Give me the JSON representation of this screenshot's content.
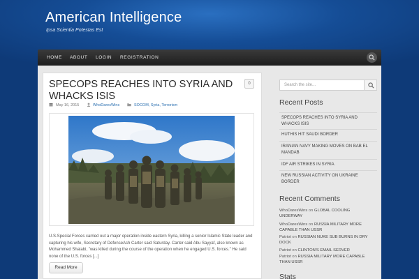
{
  "site": {
    "title": "American Intelligence",
    "tagline": "Ipsa Scientia Potestas Est"
  },
  "nav": {
    "items": [
      "HOME",
      "ABOUT",
      "LOGIN",
      "REGISTRATION"
    ],
    "search_icon": "search-icon"
  },
  "post": {
    "title_line1": "SPECOPS REACHES INTO SYRIA AND",
    "title_line2": "WHACKS ISIS",
    "comment_count": "0",
    "date": "May 16, 2015",
    "author": "WhoDaresWins",
    "categories": "SOCOM, Syria, Terrorism",
    "excerpt": "U.S.Special Forces carried out a major operation inside eastern Syria, killing a senior Islamic State leader and capturing his wife, Secretary of DefenseAsh Carter said Saturday. Carter said Abu Sayyaf, also known as Mohammed Shalabi, \"was killed during the course of the operation when he engaged U.S. forces.\" He said none of the U.S. forces [...]",
    "read_more": "Read More"
  },
  "sidebar": {
    "search_placeholder": "Search the site...",
    "recent_posts_title": "Recent Posts",
    "recent_posts": [
      [
        "SPECOPS REACHES INTO SYRIA AND",
        "WHACKS ISIS"
      ],
      [
        "HUTHIS HIT SAUDI BORDER"
      ],
      [
        "IRANIAN NAVY MAKING MOVES ON BAB EL",
        "MANDAB"
      ],
      [
        "IDF AIR STRIKES IN SYRIA"
      ],
      [
        "NEW RUSSIAN ACTIVITY ON UKRAINE",
        "BORDER"
      ]
    ],
    "recent_comments_title": "Recent Comments",
    "recent_comments": [
      {
        "author": "WhoDaresWins",
        "on": "on",
        "post_line1": "GLOBAL COOLING",
        "post_line2": "UNDERWAY"
      },
      {
        "author": "WhoDaresWins",
        "on": "on",
        "post_line1": "RUSSIA MILITARY MORE",
        "post_line2": "CAPABLE THAN USSR"
      },
      {
        "author": "Patriot",
        "on": "on",
        "post_line1": "RUSSIAN NUKE SUB BURNS IN DRY",
        "post_line2": "DOCK"
      },
      {
        "author": "Patriot",
        "on": "on",
        "post_line1": "CLINTON'S EMAIL SERVER",
        "post_line2": ""
      },
      {
        "author": "Patriot",
        "on": "on",
        "post_line1": "RUSSIA MILITARY MORE CAPABLE",
        "post_line2": "THAN USSR"
      }
    ],
    "stats_title": "Stats"
  },
  "colors": {
    "background": "#154d96",
    "nav_bar": "#2a2a2a",
    "link": "#2a6fb0"
  }
}
